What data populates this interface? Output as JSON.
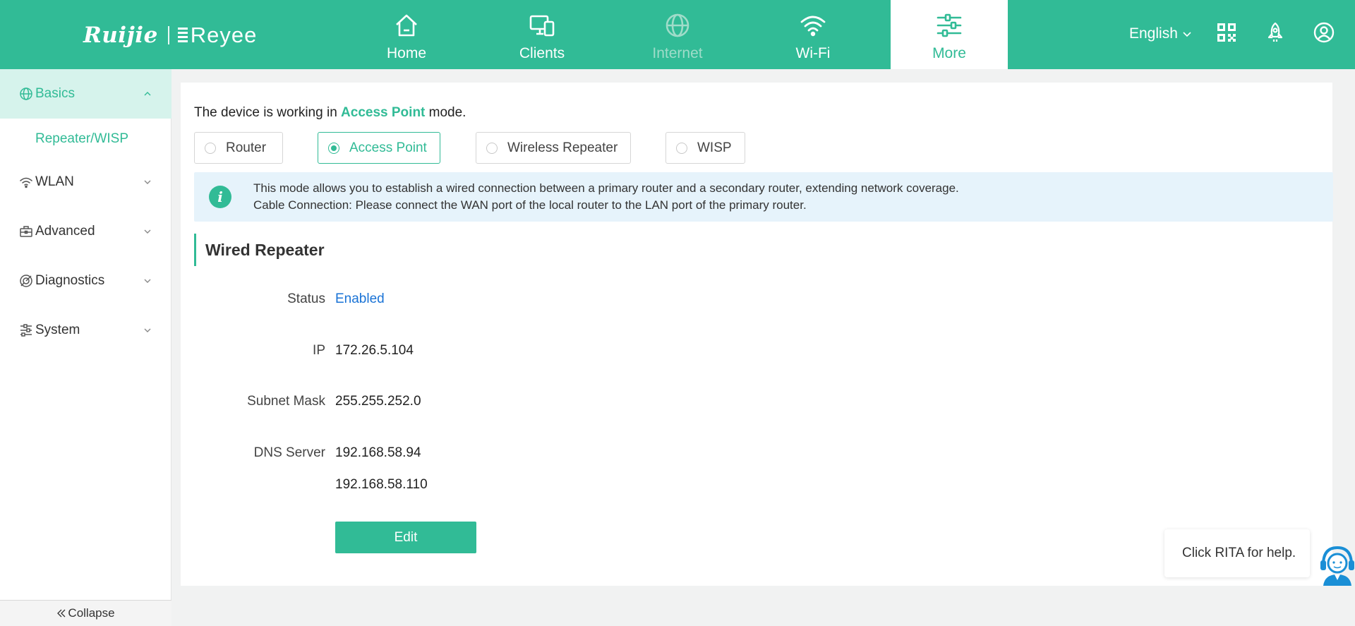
{
  "header": {
    "logo_primary": "Ruijie",
    "logo_secondary": "Reyee",
    "nav": [
      {
        "label": "Home",
        "icon": "home-icon",
        "state": "normal"
      },
      {
        "label": "Clients",
        "icon": "devices-icon",
        "state": "normal"
      },
      {
        "label": "Internet",
        "icon": "globe-icon",
        "state": "disabled"
      },
      {
        "label": "Wi-Fi",
        "icon": "wifi-icon",
        "state": "normal"
      },
      {
        "label": "More",
        "icon": "sliders-icon",
        "state": "active"
      }
    ],
    "language": "English",
    "icons": [
      "qr-code-icon",
      "rocket-icon",
      "user-icon"
    ]
  },
  "sidebar": {
    "groups": [
      {
        "label": "Basics",
        "icon": "globe-icon",
        "expanded": true
      },
      {
        "label": "WLAN",
        "icon": "wifi-icon",
        "expanded": false
      },
      {
        "label": "Advanced",
        "icon": "toolbox-icon",
        "expanded": false
      },
      {
        "label": "Diagnostics",
        "icon": "diagnostics-icon",
        "expanded": false
      },
      {
        "label": "System",
        "icon": "settings-sliders-icon",
        "expanded": false
      }
    ],
    "active_sub_item": "Repeater/WISP",
    "collapse_label": "Collapse"
  },
  "main": {
    "mode_prefix": "The device is working in",
    "mode_current": "Access Point",
    "mode_suffix": "mode.",
    "modes": [
      "Router",
      "Access Point",
      "Wireless Repeater",
      "WISP"
    ],
    "selected_mode": "Access Point",
    "info_line1": "This mode allows you to establish a wired connection between a primary router and a secondary router, extending network coverage.",
    "info_line2": "Cable Connection: Please connect the WAN port of the local router to the LAN port of the primary router.",
    "section_title": "Wired Repeater",
    "fields": {
      "status_label": "Status",
      "status_value": "Enabled",
      "ip_label": "IP",
      "ip_value": "172.26.5.104",
      "mask_label": "Subnet Mask",
      "mask_value": "255.255.252.0",
      "dns_label": "DNS Server",
      "dns_primary": "192.168.58.94",
      "dns_secondary": "192.168.58.110"
    },
    "edit_label": "Edit"
  },
  "help": {
    "text": "Click RITA for help."
  },
  "colors": {
    "brand": "#31bb96",
    "info_bg": "#e6f3fb",
    "link": "#1a73d6"
  }
}
